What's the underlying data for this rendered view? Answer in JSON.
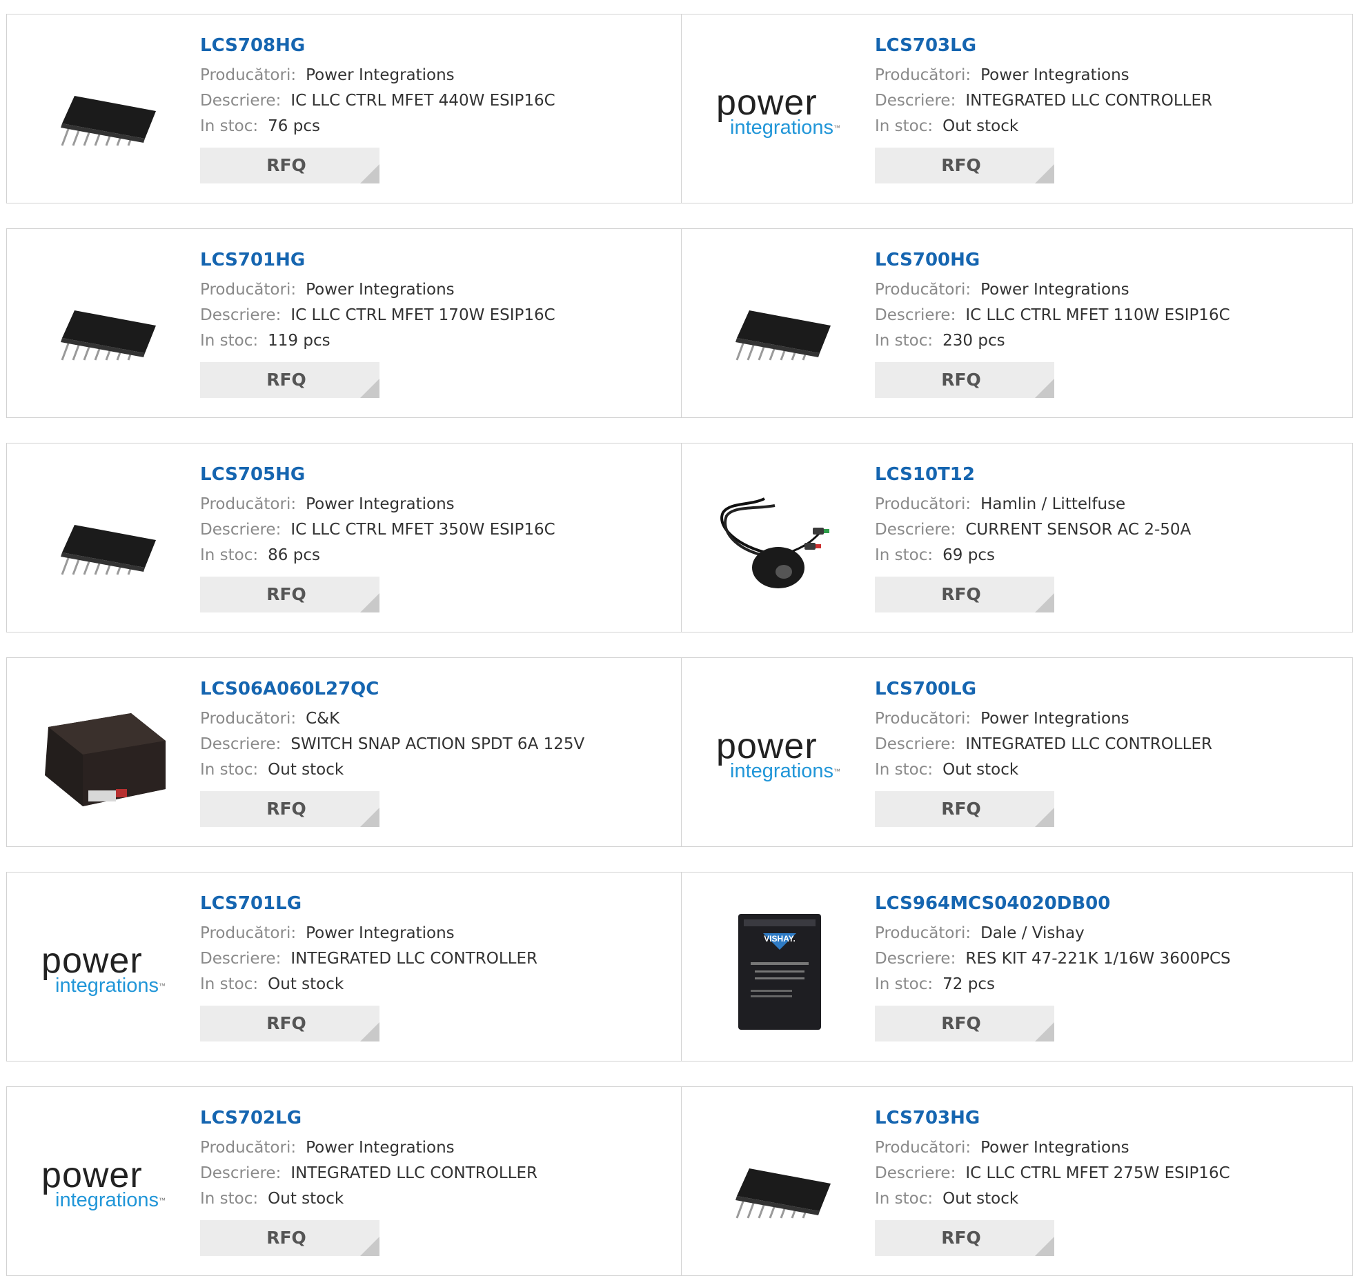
{
  "labels": {
    "manufacturer": "Producători:",
    "description": "Descriere:",
    "stock": "In stoc:",
    "rfq": "RFQ"
  },
  "logo": {
    "word1": "power",
    "word2": "integrations",
    "tm": "™"
  },
  "products": [
    {
      "name": "LCS708HG",
      "manufacturer": "Power Integrations",
      "description": "IC LLC CTRL MFET 440W ESIP16C",
      "stock": "76 pcs",
      "image": "esip16-chip"
    },
    {
      "name": "LCS703LG",
      "manufacturer": "Power Integrations",
      "description": "INTEGRATED LLC CONTROLLER",
      "stock": "Out stock",
      "image": "power-integrations-logo"
    },
    {
      "name": "LCS701HG",
      "manufacturer": "Power Integrations",
      "description": "IC LLC CTRL MFET 170W ESIP16C",
      "stock": "119 pcs",
      "image": "esip16-chip"
    },
    {
      "name": "LCS700HG",
      "manufacturer": "Power Integrations",
      "description": "IC LLC CTRL MFET 110W ESIP16C",
      "stock": "230 pcs",
      "image": "esip16-chip"
    },
    {
      "name": "LCS705HG",
      "manufacturer": "Power Integrations",
      "description": "IC LLC CTRL MFET 350W ESIP16C",
      "stock": "86 pcs",
      "image": "esip16-chip"
    },
    {
      "name": "LCS10T12",
      "manufacturer": "Hamlin / Littelfuse",
      "description": "CURRENT SENSOR AC 2-50A",
      "stock": "69 pcs",
      "image": "current-sensor"
    },
    {
      "name": "LCS06A060L27QC",
      "manufacturer": "C&K",
      "description": "SWITCH SNAP ACTION SPDT 6A 125V",
      "stock": "Out stock",
      "image": "snap-switch"
    },
    {
      "name": "LCS700LG",
      "manufacturer": "Power Integrations",
      "description": "INTEGRATED LLC CONTROLLER",
      "stock": "Out stock",
      "image": "power-integrations-logo"
    },
    {
      "name": "LCS701LG",
      "manufacturer": "Power Integrations",
      "description": "INTEGRATED LLC CONTROLLER",
      "stock": "Out stock",
      "image": "power-integrations-logo"
    },
    {
      "name": "LCS964MCS04020DB00",
      "manufacturer": "Dale / Vishay",
      "description": "RES KIT 47-221K 1/16W 3600PCS",
      "stock": "72 pcs",
      "image": "vishay-kit"
    },
    {
      "name": "LCS702LG",
      "manufacturer": "Power Integrations",
      "description": "INTEGRATED LLC CONTROLLER",
      "stock": "Out stock",
      "image": "power-integrations-logo"
    },
    {
      "name": "LCS703HG",
      "manufacturer": "Power Integrations",
      "description": "IC LLC CTRL MFET 275W ESIP16C",
      "stock": "Out stock",
      "image": "esip16-chip"
    }
  ],
  "vishay_text": "VISHAY.",
  "colors": {
    "link": "#1565b0",
    "label": "#8a8a8a",
    "border": "#d2d2d2",
    "button": "#ececec"
  }
}
